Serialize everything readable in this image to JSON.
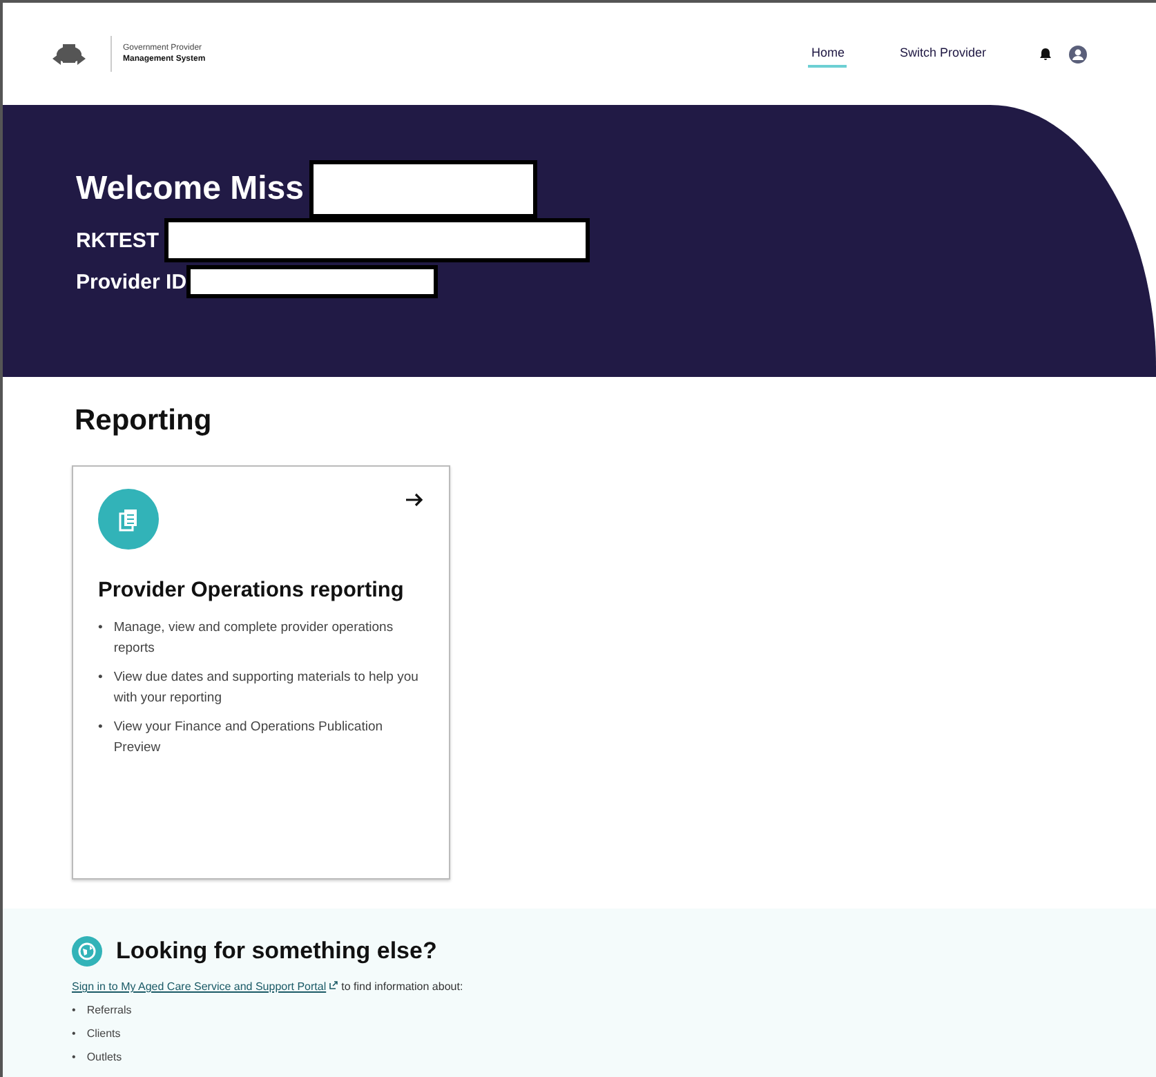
{
  "header": {
    "system_title": [
      "Government Provider",
      "Management System"
    ],
    "nav": [
      {
        "label": "Home",
        "selected": true
      },
      {
        "label": "Switch Provider",
        "selected": false
      }
    ]
  },
  "banner": {
    "welcome": "Welcome Miss",
    "org_label": "RKTEST",
    "provider_label": "Provider ID"
  },
  "reporting": {
    "heading": "Reporting",
    "cards": [
      {
        "title": "Provider Operations reporting",
        "items": [
          {
            "marker": "•",
            "text": "Manage, view and complete provider operations reports"
          },
          {
            "marker": "•",
            "text": "View due dates and supporting materials to help you with your reporting"
          },
          {
            "marker": "•",
            "text": "View your Finance and Operations Publication Preview"
          }
        ]
      }
    ]
  },
  "elsewhere": {
    "heading": "Looking for something else?",
    "link": "Sign in to My Aged Care Service and Support Portal",
    "link_suffix": "to find information about:",
    "items": [
      {
        "marker": "•",
        "text": "Referrals"
      },
      {
        "marker": "•",
        "text": "Clients"
      },
      {
        "marker": "•",
        "text": "Outlets"
      }
    ]
  }
}
